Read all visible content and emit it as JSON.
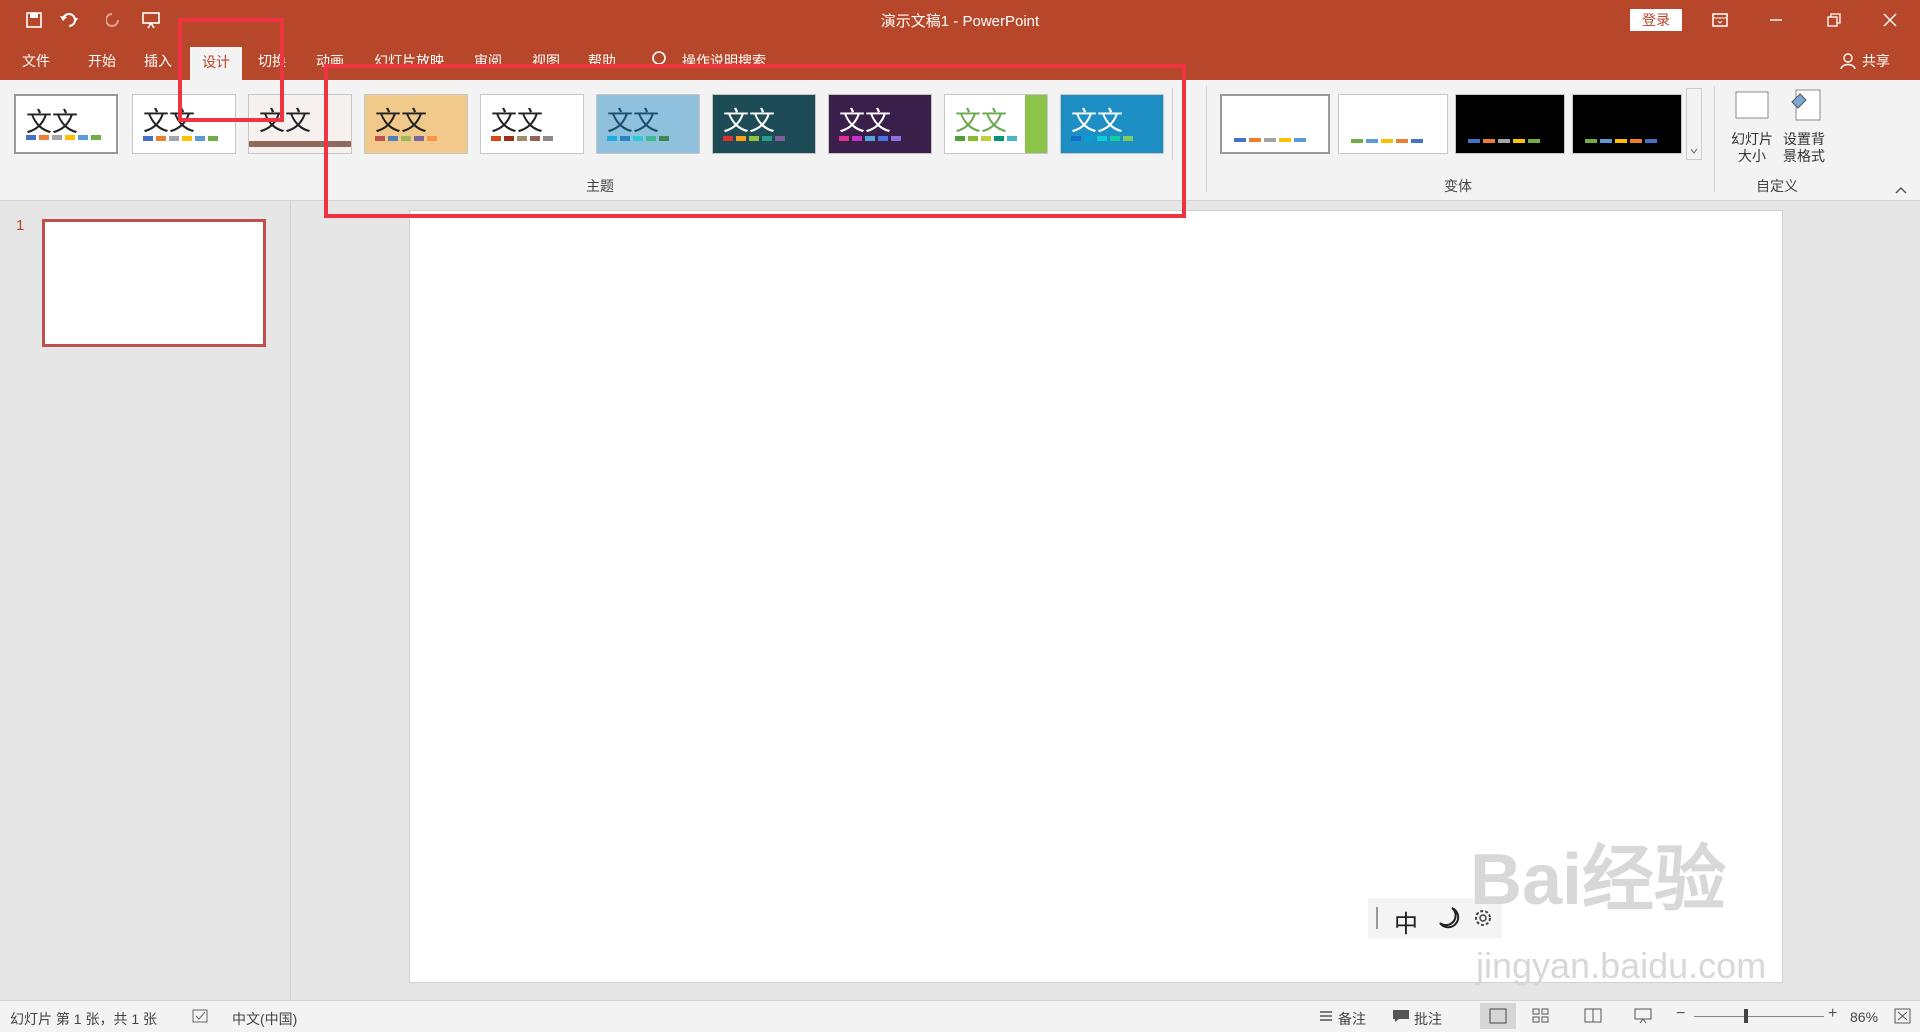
{
  "window": {
    "title": "演示文稿1  -  PowerPoint",
    "login": "登录",
    "share": "共享"
  },
  "tabs": [
    "文件",
    "开始",
    "插入",
    "设计",
    "切换",
    "动画",
    "幻灯片放映",
    "审阅",
    "视图",
    "帮助"
  ],
  "search": {
    "placeholder": "操作说明搜索"
  },
  "ribbon": {
    "themes_label": "主题",
    "variants_label": "变体",
    "customize_label": "自定义",
    "slide_size": "幻灯片大小",
    "format_background": "设置背景格式",
    "theme_sample_text": "文文"
  },
  "colors": {
    "accent": "#b7472a",
    "annotation": "#ef3340"
  },
  "thumbnails": {
    "slide_number": "1"
  },
  "status": {
    "slide_info": "幻灯片 第 1 张，共 1 张",
    "language": "中文(中国)",
    "notes": "备注",
    "comments": "批注",
    "zoom": "86%"
  },
  "ime": {
    "mode": "中"
  },
  "watermark": {
    "line1": "Bai经验",
    "line2": "jingyan.baidu.com"
  }
}
